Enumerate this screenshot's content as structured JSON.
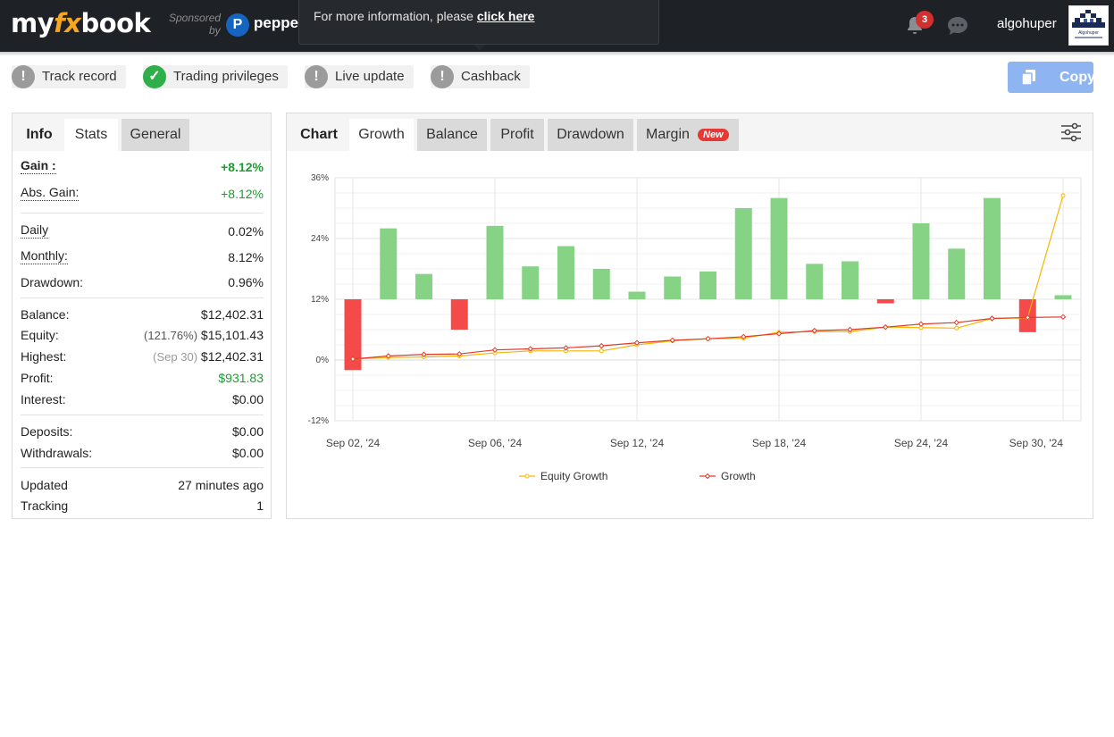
{
  "header": {
    "logo_my": "my",
    "logo_fx": "fx",
    "logo_book": "book",
    "sponsored_label": "Sponsored",
    "sponsored_by": "by",
    "sponsor_mark": "P",
    "sponsor_name": "pepper",
    "tooltip_text": "For more information, please ",
    "tooltip_link": "click here",
    "notification_count": "3",
    "username": "algohuper",
    "avatar_text": "Algohuper"
  },
  "status": {
    "items": [
      {
        "label": "Track record",
        "state": "warning"
      },
      {
        "label": "Trading privileges",
        "state": "ok"
      },
      {
        "label": "Live update",
        "state": "warning"
      },
      {
        "label": "Cashback",
        "state": "warning"
      }
    ],
    "copy_label": "Copy"
  },
  "left_panel": {
    "tabs": [
      "Info",
      "Stats",
      "General"
    ],
    "rows": {
      "gain": {
        "label": "Gain :",
        "value": "+8.12%"
      },
      "abs_gain": {
        "label": "Abs. Gain:",
        "value": "+8.12%"
      },
      "daily": {
        "label": "Daily",
        "value": "0.02%"
      },
      "monthly": {
        "label": "Monthly:",
        "value": "8.12%"
      },
      "drawdown": {
        "label": "Drawdown:",
        "value": "0.96%"
      },
      "balance": {
        "label": "Balance:",
        "value": "$12,402.31"
      },
      "equity": {
        "label": "Equity:",
        "sub": "(121.76%)",
        "value": "$15,101.43"
      },
      "highest": {
        "label": "Highest:",
        "sub": "(Sep 30)",
        "value": "$12,402.31"
      },
      "profit": {
        "label": "Profit:",
        "value": "$931.83"
      },
      "interest": {
        "label": "Interest:",
        "value": "$0.00"
      },
      "deposits": {
        "label": "Deposits:",
        "value": "$0.00"
      },
      "withdrawals": {
        "label": "Withdrawals:",
        "value": "$0.00"
      },
      "updated": {
        "label": "Updated",
        "value": "27 minutes ago"
      },
      "tracking": {
        "label": "Tracking",
        "value": "1"
      }
    }
  },
  "chart_panel": {
    "tabs": [
      "Chart",
      "Growth",
      "Balance",
      "Profit",
      "Drawdown",
      "Margin"
    ],
    "new_badge": "New"
  },
  "chart_data": {
    "type": "bar",
    "title": "",
    "xlabel": "",
    "ylabel": "",
    "ylim": [
      -12,
      36
    ],
    "y_ticks": [
      "36%",
      "24%",
      "12%",
      "0%",
      "-12%"
    ],
    "y_tick_values": [
      36,
      24,
      12,
      0,
      -12
    ],
    "x_tick_labels": [
      "Sep 02, '24",
      "Sep 06, '24",
      "Sep 12, '24",
      "Sep 18, '24",
      "Sep 24, '24",
      "Sep 30, '24"
    ],
    "x_tick_index": [
      0,
      4,
      8,
      12,
      16,
      20
    ],
    "grid": true,
    "legend_position": "bottom",
    "legend": [
      "Equity Growth",
      "Growth"
    ],
    "colors": {
      "positive_bar": "#87d386",
      "negative_bar": "#f44a4a",
      "equity_line": "#f6b600",
      "growth_line": "#e03a2c",
      "grid": "#e6e6e6"
    },
    "bar_baseline": 12,
    "bar_tops": [
      -2,
      26,
      17,
      6,
      26.5,
      18.5,
      22.5,
      18,
      13.5,
      16.5,
      17.5,
      30,
      32,
      19,
      19.5,
      11.2,
      27,
      22,
      32,
      5.5,
      12.8
    ],
    "series": [
      {
        "name": "Equity Growth",
        "values": [
          0.2,
          0.5,
          0.6,
          0.8,
          1.4,
          1.8,
          1.8,
          1.8,
          3.0,
          3.8,
          4.2,
          4.3,
          5.5,
          5.6,
          5.6,
          6.5,
          6.4,
          6.3,
          8.2,
          8.3,
          32.5
        ]
      },
      {
        "name": "Growth",
        "values": [
          0.2,
          0.8,
          1.1,
          1.2,
          2.0,
          2.2,
          2.4,
          2.8,
          3.4,
          3.9,
          4.2,
          4.6,
          5.2,
          5.8,
          6.0,
          6.5,
          7.1,
          7.4,
          8.2,
          8.4,
          8.5
        ]
      }
    ]
  }
}
